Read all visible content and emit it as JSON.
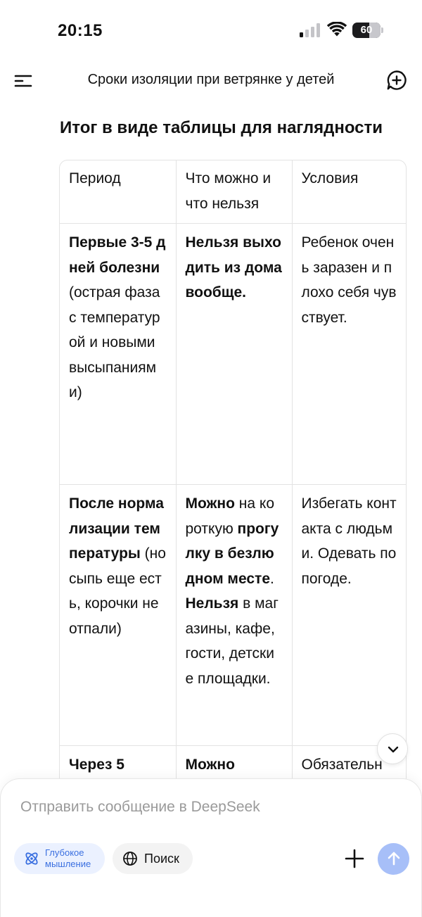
{
  "status_bar": {
    "time": "20:15",
    "battery_level": "60",
    "battery_fraction": 0.6
  },
  "header": {
    "title": "Сроки изоляции при ветрянке у детей",
    "menu_icon": "menu-icon",
    "new_chat_icon": "new-chat-plus-icon"
  },
  "message": {
    "heading": "Итог в виде таблицы для наглядности",
    "table": {
      "headers": [
        "Период",
        "Что можно и что нельзя",
        "Условия"
      ],
      "rows": [
        {
          "period_bold": "Первые 3-5 дней болезни",
          "period_rest": " (острая фаза с температурой и новыми высыпаниями)",
          "rules": [
            {
              "bold": true,
              "text": "Нельзя выходить из дома вообще."
            }
          ],
          "conditions": "Ребенок очень заразен и плохо себя чувствует."
        },
        {
          "period_bold": "После нормализации температуры",
          "period_rest": " (но сыпь еще есть, корочки не отпали)",
          "rules": [
            {
              "bold": true,
              "text": "Можно"
            },
            {
              "bold": false,
              "text": " на короткую "
            },
            {
              "bold": true,
              "text": "прогулку в безлюдном месте"
            },
            {
              "bold": false,
              "text": ". "
            },
            {
              "bold": true,
              "text": "Нельзя"
            },
            {
              "bold": false,
              "text": " в магазины, кафе, гости, детские площадки."
            }
          ],
          "conditions": "Избегать контакта с людьми. Одевать по погоде."
        },
        {
          "period_bold": "Через 5",
          "period_rest": "",
          "rules": [
            {
              "bold": true,
              "text": "Можно"
            }
          ],
          "conditions": "Обязательн"
        }
      ]
    }
  },
  "composer": {
    "placeholder": "Отправить сообщение в DeepSeek",
    "deep_think_label": "Глубокое мышление",
    "search_label": "Поиск",
    "accent_color": "#4d6bfe",
    "send_button_color": "#a7bff8"
  }
}
